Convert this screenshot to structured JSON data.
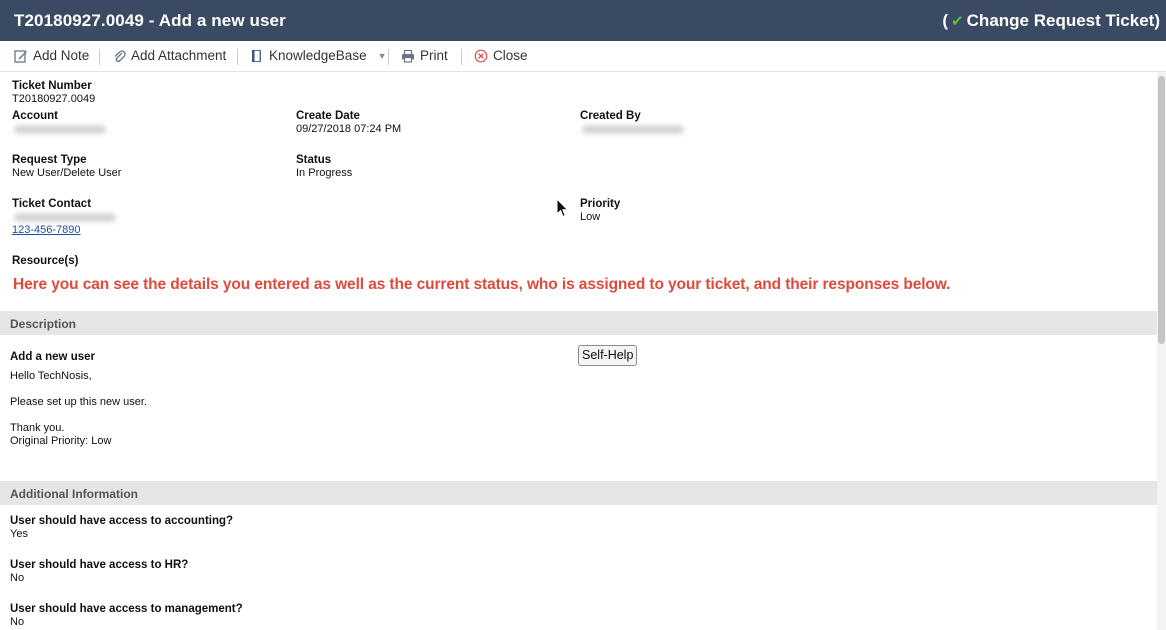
{
  "window": {
    "title": "T20180927.0049 - Add a new user",
    "ticket_type_prefix": "(",
    "ticket_type": "Change Request Ticket)"
  },
  "toolbar": {
    "add_note": "Add Note",
    "add_attachment": "Add Attachment",
    "knowledgebase": "KnowledgeBase",
    "print": "Print",
    "close": "Close"
  },
  "details": {
    "ticket_number_label": "Ticket Number",
    "ticket_number": "T20180927.0049",
    "account_label": "Account",
    "create_date_label": "Create Date",
    "create_date": "09/27/2018 07:24 PM",
    "created_by_label": "Created By",
    "request_type_label": "Request Type",
    "request_type": "New User/Delete User",
    "status_label": "Status",
    "status": "In Progress",
    "ticket_contact_label": "Ticket Contact",
    "contact_phone": "123-456-7890",
    "priority_label": "Priority",
    "priority": "Low",
    "resources_label": "Resource(s)"
  },
  "annotation": "Here you can see the details you entered as well as the current status, who is assigned to your ticket, and their responses below.",
  "description": {
    "header": "Description",
    "subject": "Add a new user",
    "self_help": "Self-Help",
    "lines": [
      "Hello TechNosis,",
      "Please set up this new user.",
      "Thank you.",
      "Original Priority: Low"
    ]
  },
  "additional": {
    "header": "Additional Information",
    "items": [
      {
        "question": "User should have access to accounting?",
        "answer": "Yes"
      },
      {
        "question": "User should have access to HR?",
        "answer": "No"
      },
      {
        "question": "User should have access to management?",
        "answer": "No"
      }
    ]
  },
  "colors": {
    "titlebar": "#3a4a63",
    "annotation": "#e04a3a",
    "section_bar": "#e6e6e6",
    "link": "#1d4fa0"
  }
}
